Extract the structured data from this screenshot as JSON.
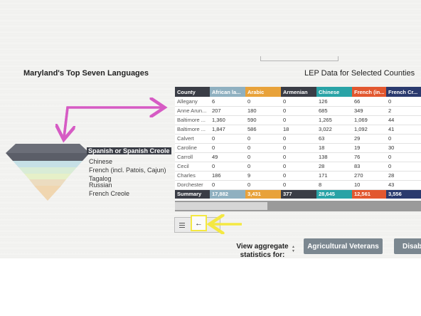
{
  "left_title": "Maryland's Top Seven Languages",
  "right_title": "LEP Data for Selected Counties",
  "languages": [
    "Spanish or Spanish Creole",
    "Chinese",
    "French (incl. Patois, Cajun)",
    "Tagalog",
    "Russian",
    "French Creole"
  ],
  "table": {
    "columns": [
      {
        "label": "County",
        "color": "#3a3d46"
      },
      {
        "label": "African la...",
        "color": "#8fb0c0"
      },
      {
        "label": "Arabic",
        "color": "#e8a23a"
      },
      {
        "label": "Armenian",
        "color": "#3a3d46"
      },
      {
        "label": "Chinese",
        "color": "#29a3a6"
      },
      {
        "label": "French (in...",
        "color": "#e2572f"
      },
      {
        "label": "French Cr...",
        "color": "#2a3a6e"
      }
    ],
    "rows": [
      [
        "Allegany",
        "6",
        "0",
        "0",
        "126",
        "66",
        "0"
      ],
      [
        "Anne Arun...",
        "207",
        "180",
        "0",
        "685",
        "349",
        "2"
      ],
      [
        "Baltimore ...",
        "1,360",
        "590",
        "0",
        "1,265",
        "1,069",
        "44"
      ],
      [
        "Baltimore ...",
        "1,847",
        "586",
        "18",
        "3,022",
        "1,092",
        "41"
      ],
      [
        "Calvert",
        "0",
        "0",
        "0",
        "63",
        "29",
        "0"
      ],
      [
        "Caroline",
        "0",
        "0",
        "0",
        "18",
        "19",
        "30"
      ],
      [
        "Carroll",
        "49",
        "0",
        "0",
        "138",
        "76",
        "0"
      ],
      [
        "Cecil",
        "0",
        "0",
        "0",
        "28",
        "83",
        "0"
      ],
      [
        "Charles",
        "186",
        "9",
        "0",
        "171",
        "270",
        "28"
      ],
      [
        "Dorchester",
        "0",
        "0",
        "0",
        "8",
        "10",
        "43"
      ]
    ],
    "summary": [
      "Summary",
      "17,882",
      "3,431",
      "377",
      "28,645",
      "12,561",
      "3,556"
    ]
  },
  "controls": {
    "back_icon": "←"
  },
  "aggregate": {
    "label": "View aggregate statistics for:",
    "buttons": [
      "Agricultural Veterans",
      "Disab"
    ]
  },
  "colors": {
    "highlight_yellow": "#f4e842",
    "annotation_pink": "#d65bc4"
  }
}
